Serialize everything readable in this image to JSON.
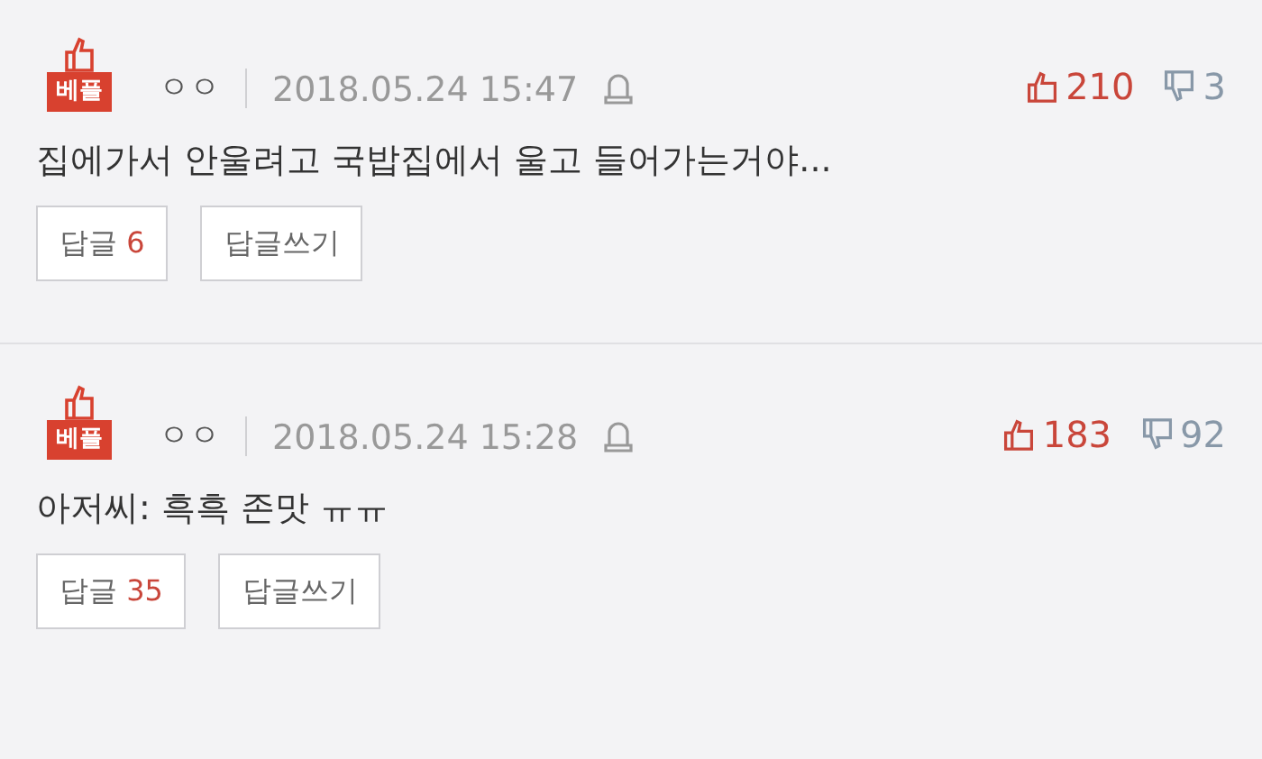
{
  "comments": [
    {
      "badge": "베플",
      "author": "ㅇㅇ",
      "date": "2018.05.24 15:47",
      "likes": "210",
      "dislikes": "3",
      "text": "집에가서 안울려고 국밥집에서 울고 들어가는거야...",
      "reply_label": "답글",
      "reply_count": "6",
      "write_reply": "답글쓰기"
    },
    {
      "badge": "베플",
      "author": "ㅇㅇ",
      "date": "2018.05.24 15:28",
      "likes": "183",
      "dislikes": "92",
      "text": "아저씨: 흑흑 존맛 ㅠㅠ",
      "reply_label": "답글",
      "reply_count": "35",
      "write_reply": "답글쓰기"
    }
  ]
}
